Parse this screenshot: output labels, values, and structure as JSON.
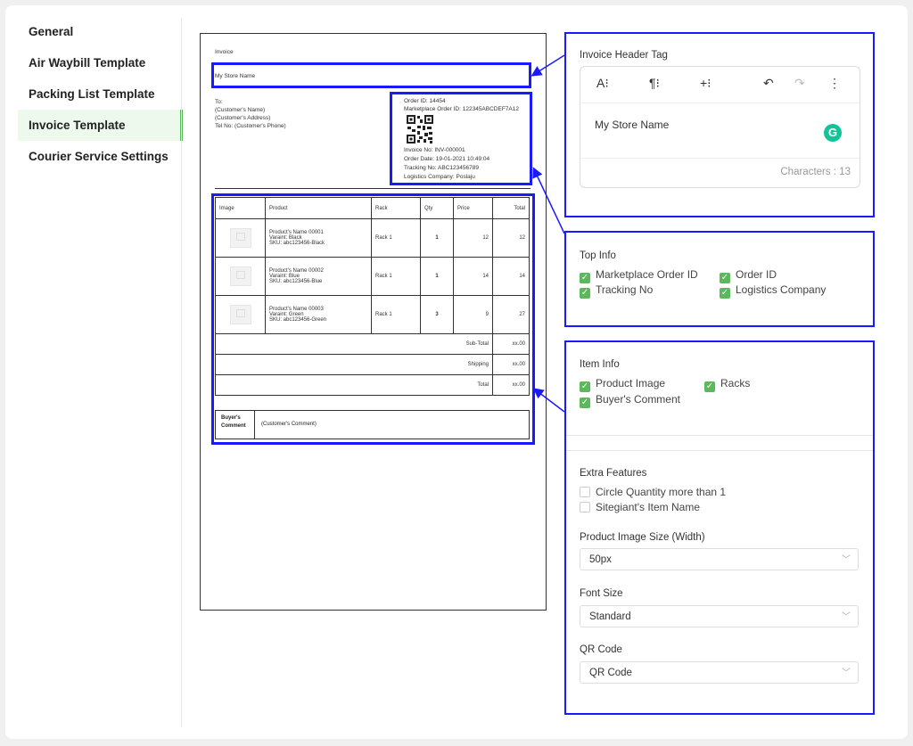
{
  "sidebar": {
    "items": [
      {
        "label": "General"
      },
      {
        "label": "Air Waybill Template"
      },
      {
        "label": "Packing List Template"
      },
      {
        "label": "Invoice Template"
      },
      {
        "label": "Courier Service Settings"
      }
    ]
  },
  "invoice": {
    "title": "Invoice",
    "store_name": "My Store Name",
    "to_label": "To:",
    "customer_name": "(Customer's Name)",
    "customer_address": "(Customer's Address)",
    "tel": "Tel No: (Customer's Phone)",
    "order_id": "Order ID: 14454",
    "marketplace_order_id": "Marketplace Order ID: 122345ABCDEF7A12",
    "invoice_no": "Invoice No: INV-000001",
    "order_date": "Order Date: 19-01-2021 10:49:04",
    "tracking_no": "Tracking No: ABC123456789",
    "logistics_company": "Logistics Company: Poslaju",
    "columns": [
      "Image",
      "Product",
      "Rack",
      "Qty",
      "Price",
      "Total"
    ],
    "items": [
      {
        "name": "Product's Name 00001",
        "variant": "Varaint: Black",
        "sku": "SKU: abc123456-Black",
        "rack": "Rack 1",
        "qty": "1",
        "price": "12",
        "total": "12"
      },
      {
        "name": "Product's Name 00002",
        "variant": "Varaint: Blue",
        "sku": "SKU: abc123456-Blue",
        "rack": "Rack 1",
        "qty": "1",
        "price": "14",
        "total": "14"
      },
      {
        "name": "Product's Name 00003",
        "variant": "Varaint: Green",
        "sku": "SKU: abc123456-Green",
        "rack": "Rack 1",
        "qty": "3",
        "price": "9",
        "total": "27"
      }
    ],
    "subtotal_label": "Sub-Total",
    "subtotal_value": "xx.00",
    "shipping_label": "Shipping",
    "shipping_value": "xx.00",
    "total_label": "Total",
    "total_value": "xx.00",
    "buyers_comment_label": "Buyer's Comment",
    "buyers_comment_value": "(Customer's Comment)"
  },
  "header_panel": {
    "title": "Invoice Header Tag",
    "toolbar": [
      {
        "icon": "font-size-icon",
        "glyph": "A⁝"
      },
      {
        "icon": "paragraph-icon",
        "glyph": "¶⁝"
      },
      {
        "icon": "insert-icon",
        "glyph": "+⁝"
      },
      {
        "icon": "undo-icon",
        "glyph": "↶"
      },
      {
        "icon": "redo-icon",
        "glyph": "↷"
      },
      {
        "icon": "more-icon",
        "glyph": "⋮"
      }
    ],
    "content": "My Store Name",
    "characters": "Characters : 13"
  },
  "top_info": {
    "title": "Top Info",
    "options": [
      {
        "label": "Marketplace Order ID",
        "checked": true
      },
      {
        "label": "Order ID",
        "checked": true
      },
      {
        "label": "Tracking No",
        "checked": true
      },
      {
        "label": "Logistics Company",
        "checked": true
      }
    ]
  },
  "item_info": {
    "title": "Item Info",
    "options": [
      {
        "label": "Product Image",
        "checked": true
      },
      {
        "label": "Racks",
        "checked": true
      },
      {
        "label": "Buyer's Comment",
        "checked": true
      }
    ]
  },
  "extra": {
    "title": "Extra Features",
    "options": [
      {
        "label": "Circle Quantity more than 1",
        "checked": false
      },
      {
        "label": "Sitegiant's Item Name",
        "checked": false
      }
    ],
    "image_size_label": "Product Image Size (Width)",
    "image_size_value": "50px",
    "font_size_label": "Font Size",
    "font_size_value": "Standard",
    "qr_label": "QR Code",
    "qr_value": "QR Code"
  },
  "colors": {
    "accent": "#5cb85c",
    "highlight": "#1a1aff"
  }
}
